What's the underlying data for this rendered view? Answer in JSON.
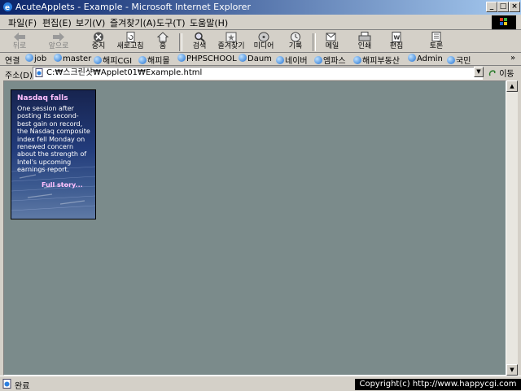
{
  "window": {
    "title": "AcuteApplets - Example - Microsoft Internet Explorer",
    "minimize": "_",
    "maximize": "□",
    "close": "×"
  },
  "menu": [
    "파일(F)",
    "편집(E)",
    "보기(V)",
    "즐겨찾기(A)",
    "도구(T)",
    "도움말(H)"
  ],
  "toolbar": {
    "back": "뒤로",
    "forward": "앞으로",
    "stop": "중지",
    "refresh": "새로고침",
    "home": "홈",
    "search": "검색",
    "favorites": "즐겨찾기",
    "media": "미디어",
    "history": "기록",
    "mail": "메일",
    "print": "인쇄",
    "edit": "편집",
    "discuss": "토론"
  },
  "links": {
    "label": "연결",
    "items": [
      "job",
      "master",
      "해피CGI",
      "해피몰",
      "PHPSCHOOL",
      "Daum",
      "네이버",
      "엠파스",
      "해피부동산",
      "Admin",
      "국민"
    ],
    "more": "»"
  },
  "address": {
    "label": "주소(D)",
    "value": "C:₩스크린샷₩Applet01₩Example.html",
    "go": "이동"
  },
  "applet": {
    "headline": "Nasdaq falls",
    "body": "One session after posting its second-best gain on record, the Nasdaq composite index fell Monday on renewed concern about the strength of Intel's upcoming earnings report.",
    "link": "Full story..."
  },
  "status": {
    "text": "완료",
    "copyright": "Copyright(c) http://www.happycgi.com"
  }
}
